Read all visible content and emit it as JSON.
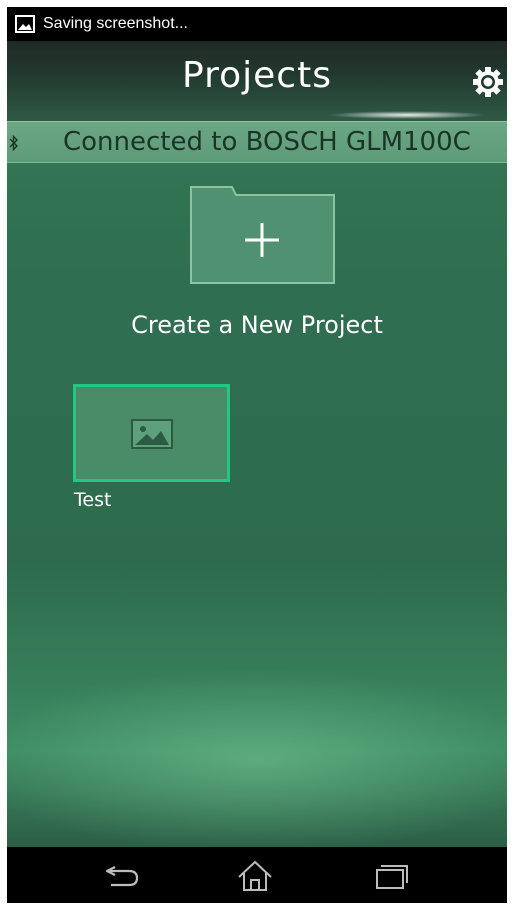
{
  "status_bar": {
    "notification_text": "Saving screenshot...",
    "notification_icon": "image-icon"
  },
  "header": {
    "title": "Projects",
    "settings_icon": "gear-icon"
  },
  "connection": {
    "icon": "bluetooth-icon",
    "text": "Connected to BOSCH GLM100C"
  },
  "new_project": {
    "icon": "folder-add-icon",
    "label": "Create a New Project"
  },
  "projects": [
    {
      "name": "Test",
      "thumbnail_icon": "image-placeholder-icon",
      "selected": true
    }
  ],
  "nav_bar": {
    "buttons": [
      "back-icon",
      "home-icon",
      "recents-icon"
    ]
  },
  "colors": {
    "app_background": "#2f6f50",
    "banner": "#62a07c",
    "tile_border": "#21c785",
    "bar": "#000000"
  }
}
